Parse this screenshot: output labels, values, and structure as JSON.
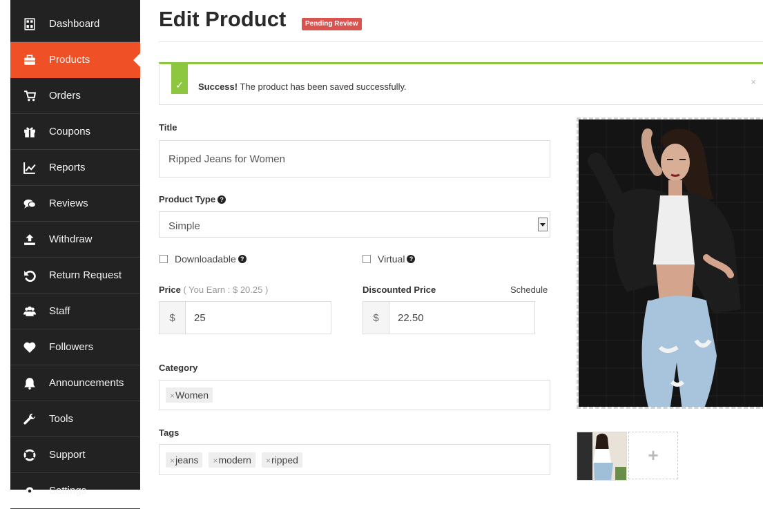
{
  "sidebar": {
    "items": [
      {
        "label": "Dashboard",
        "icon": "dashboard-icon"
      },
      {
        "label": "Products",
        "icon": "briefcase-icon",
        "active": true
      },
      {
        "label": "Orders",
        "icon": "cart-icon"
      },
      {
        "label": "Coupons",
        "icon": "gift-icon"
      },
      {
        "label": "Reports",
        "icon": "chart-icon"
      },
      {
        "label": "Reviews",
        "icon": "comments-icon"
      },
      {
        "label": "Withdraw",
        "icon": "upload-icon"
      },
      {
        "label": "Return Request",
        "icon": "undo-icon"
      },
      {
        "label": "Staff",
        "icon": "users-icon"
      },
      {
        "label": "Followers",
        "icon": "heart-icon"
      },
      {
        "label": "Announcements",
        "icon": "bell-icon"
      },
      {
        "label": "Tools",
        "icon": "wrench-icon"
      },
      {
        "label": "Support",
        "icon": "lifebuoy-icon"
      },
      {
        "label": "Settings",
        "icon": "gear-icon"
      }
    ]
  },
  "header": {
    "title": "Edit Product",
    "status_badge": "Pending Review"
  },
  "alert": {
    "strong": "Success!",
    "message": "The product has been saved successfully.",
    "close": "×",
    "check": "✓"
  },
  "form": {
    "title_label": "Title",
    "title_value": "Ripped Jeans for Women",
    "product_type_label": "Product Type",
    "product_type_value": "Simple",
    "downloadable_label": "Downloadable",
    "virtual_label": "Virtual",
    "price_label": "Price",
    "price_earn": "( You Earn : $ 20.25 )",
    "price_currency": "$",
    "price_value": "25",
    "discount_label": "Discounted Price",
    "schedule_link": "Schedule",
    "discount_currency": "$",
    "discount_value": "22.50",
    "category_label": "Category",
    "categories": [
      "Women"
    ],
    "tags_label": "Tags",
    "tags": [
      "jeans",
      "modern",
      "ripped"
    ],
    "tag_remove": "×"
  },
  "gallery": {
    "add": "+"
  },
  "colors": {
    "accent": "#f05025",
    "sidebar": "#222222",
    "success": "#8dc63f",
    "badge": "#d9534f"
  }
}
